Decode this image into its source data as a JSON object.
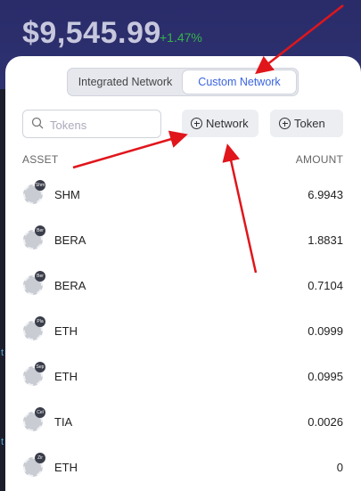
{
  "header": {
    "balance": "$9,545.99",
    "change": "+1.47%"
  },
  "tabs": [
    {
      "label": "Integrated Network"
    },
    {
      "label": "Custom Network"
    }
  ],
  "search": {
    "placeholder": "Tokens"
  },
  "buttons": {
    "network": "Network",
    "token": "Token"
  },
  "columns": {
    "asset": "ASSET",
    "amount": "AMOUNT"
  },
  "assets": [
    {
      "symbol": "SHM",
      "badge": "Shm",
      "amount": "6.9943"
    },
    {
      "symbol": "BERA",
      "badge": "Ber",
      "amount": "1.8831"
    },
    {
      "symbol": "BERA",
      "badge": "Ber",
      "amount": "0.7104"
    },
    {
      "symbol": "ETH",
      "badge": "Pla",
      "amount": "0.0999"
    },
    {
      "symbol": "ETH",
      "badge": "Sep",
      "amount": "0.0995"
    },
    {
      "symbol": "TIA",
      "badge": "Cel",
      "amount": "0.0026"
    },
    {
      "symbol": "ETH",
      "badge": "Zir",
      "amount": "0"
    }
  ],
  "colors": {
    "accent": "#3a64e0",
    "positive": "#35b34a",
    "arrow": "#e0161b"
  }
}
